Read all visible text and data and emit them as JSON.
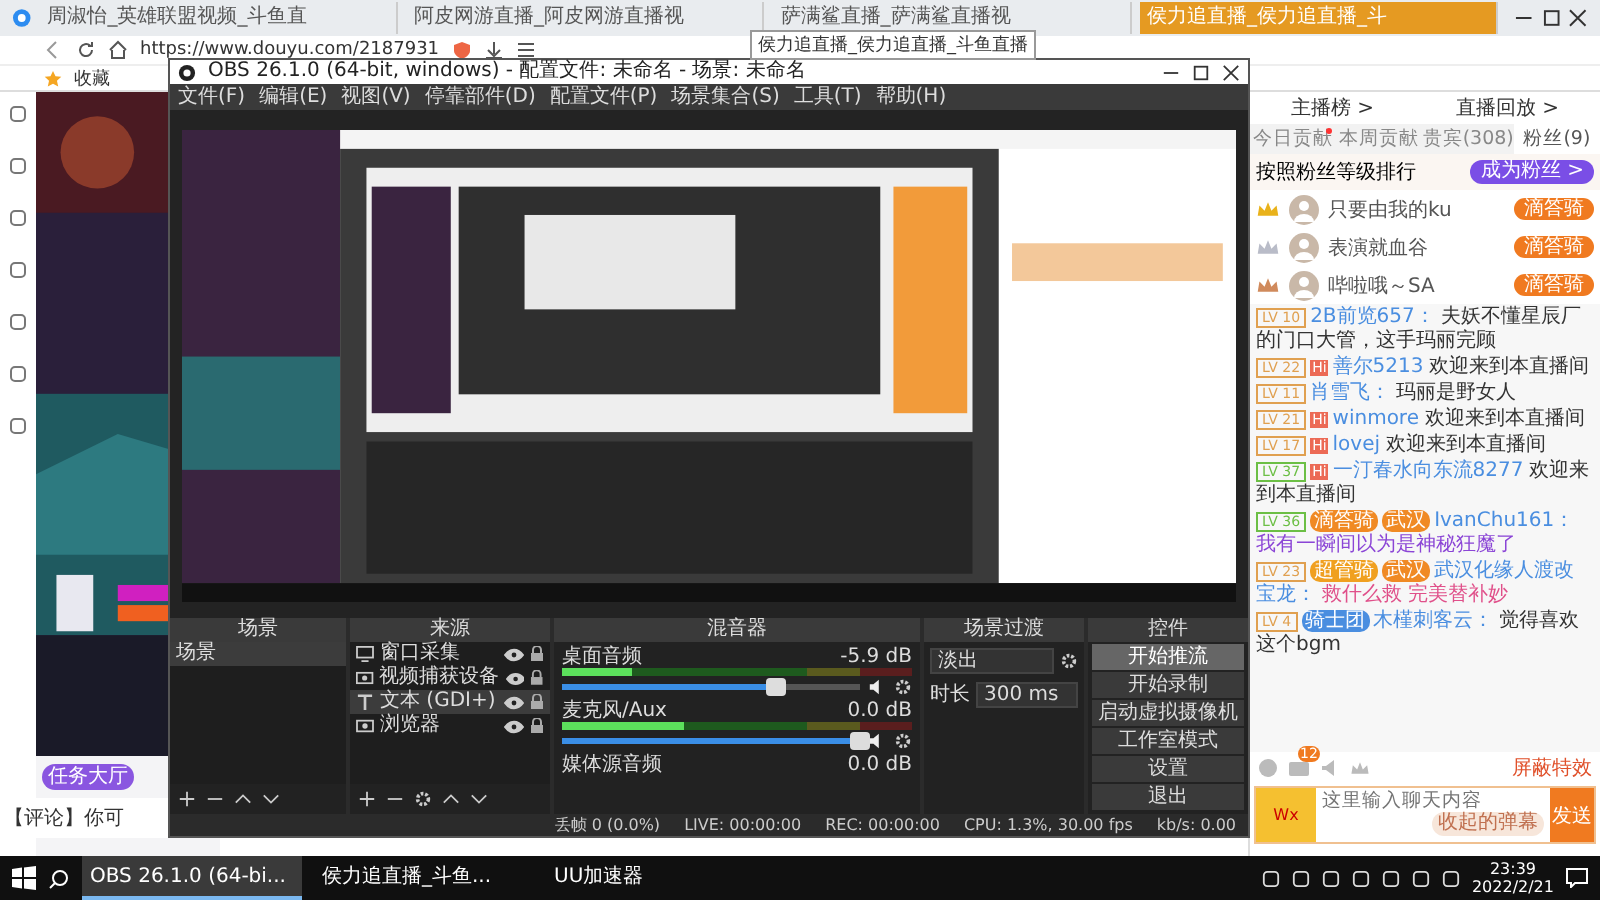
{
  "browser": {
    "tabs": [
      {
        "label": "周淑怡_英雄联盟视频_斗鱼直",
        "selected": false
      },
      {
        "label": "阿皮网游直播_阿皮网游直播视",
        "selected": false
      },
      {
        "label": "萨满鲨直播_萨满鲨直播视",
        "selected": false
      },
      {
        "label": "侯力追直播_侯力追直播_斗",
        "selected": true
      }
    ],
    "tooltip": "侯力追直播_侯力追直播_斗鱼直播",
    "address": "https://www.douyu.com/2187931",
    "bookmarks": [
      "收藏"
    ]
  },
  "stream": {
    "kind": "picture",
    "task_buttons": [
      "任务大厅"
    ],
    "notice": "【评论】你可"
  },
  "chat": {
    "links": [
      "主播榜 >",
      "直播回放 >"
    ],
    "tabs": [
      {
        "label": "今日贡献",
        "selected": false,
        "dot": true
      },
      {
        "label": "本周贡献",
        "selected": false,
        "dot": false
      },
      {
        "label": "贵宾(308)",
        "selected": false,
        "dot": false
      },
      {
        "label": "粉丝(9)",
        "selected": true,
        "dot": false
      }
    ],
    "rank_title": "按照粉丝等级排行",
    "join_button": "成为粉丝 >",
    "fans": [
      {
        "name": "只要由我的ku",
        "badge": "滴答骑",
        "crown": {
          "color": "#e9b21b"
        }
      },
      {
        "name": "表演就血谷",
        "badge": "滴答骑",
        "crown": {
          "color": "#b9bcc8"
        }
      },
      {
        "name": "哔啦哦～SA",
        "badge": "滴答骑",
        "crown": {
          "color": "#d08a5c"
        }
      }
    ],
    "messages": [
      {
        "tag": {
          "text": "LV 10",
          "color": "#e0a050"
        },
        "user": "2B前览657：",
        "text": "夫妖不懂星辰厂的门口大管，这手玛丽完顾",
        "color": "#333333"
      },
      {
        "tag": {
          "text": "LV 22",
          "color": "#e0a050"
        },
        "hi": "Hi",
        "user": "善尔5213",
        "text": "欢迎来到本直播间",
        "color": "#333333"
      },
      {
        "tag": {
          "text": "LV 11",
          "color": "#e0a050"
        },
        "user": "肖雪飞：",
        "text": "玛丽是野女人",
        "color": "#333333"
      },
      {
        "tag": {
          "text": "LV 21",
          "color": "#e0a050"
        },
        "hi": "Hi",
        "user": "winmore",
        "text": "欢迎来到本直播间",
        "color": "#333333"
      },
      {
        "tag": {
          "text": "LV 17",
          "color": "#e0a050"
        },
        "hi": "Hi",
        "user": "lovej",
        "text": "欢迎来到本直播间",
        "color": "#333333"
      },
      {
        "tag": {
          "text": "LV 37",
          "color": "#6cbf45"
        },
        "hi": "Hi",
        "user": "一汀春水向东流8277",
        "text": "欢迎来到本直播间",
        "color": "#333333"
      },
      {
        "tag": {
          "text": "LV 36",
          "color": "#6cbf45"
        },
        "badges": [
          {
            "text": "滴答骑",
            "color": "#f08a24"
          },
          {
            "text": "武汉",
            "color": "#f08a24"
          }
        ],
        "user": "IvanChu161：",
        "text": "我有一瞬间以为是神秘狂魔了",
        "color": "#8b45d6"
      },
      {
        "tag": {
          "text": "LV 23",
          "color": "#e0a050"
        },
        "badges": [
          {
            "text": "超管骑",
            "color": "#f0a020"
          },
          {
            "text": "武汉",
            "color": "#f08a24"
          }
        ],
        "user": "武汉化缘人渡改宝龙：",
        "text": "救什么救 完美替补妙",
        "color": "#e0508a"
      },
      {
        "tag": {
          "text": "LV 4",
          "color": "#e0a050"
        },
        "badges": [
          {
            "text": "骑士团",
            "color": "#4a8ee0"
          }
        ],
        "user": "木槿刺客云：",
        "text": "觉得喜欢这个bgm",
        "color": "#333333"
      }
    ],
    "unread": "12",
    "shield": "屏蔽特效",
    "input": {
      "placeholder": "这里输入聊天内容"
    },
    "collapse": "收起的弹幕",
    "send": "发送",
    "gift": "Wx"
  },
  "obs": {
    "title": "OBS 26.1.0 (64-bit, windows) - 配置文件: 未命名 - 场景: 未命名",
    "menu": [
      "文件(F)",
      "编辑(E)",
      "视图(V)",
      "停靠部件(D)",
      "配置文件(P)",
      "场景集合(S)",
      "工具(T)",
      "帮助(H)"
    ],
    "preview": {
      "kind": "picture"
    },
    "docks": [
      "场景",
      "来源",
      "混音器",
      "场景过渡",
      "控件"
    ],
    "scenes": [
      {
        "label": "场景",
        "selected": true
      }
    ],
    "sources": [
      {
        "label": "窗口采集",
        "kind": "monitor",
        "selected": false,
        "visible": true
      },
      {
        "label": "视频捕获设备",
        "kind": "camera",
        "selected": false,
        "visible": true
      },
      {
        "label": "文本 (GDI+)",
        "kind": "text",
        "selected": true,
        "visible": true
      },
      {
        "label": "浏览器",
        "kind": "camera",
        "selected": false,
        "visible": true
      }
    ],
    "mixer": [
      {
        "name": "桌面音频",
        "reading": "-5.9 dB",
        "meter": {
          "level": 0.2
        },
        "fader": {
          "level": 0.72
        }
      },
      {
        "name": "麦克风/Aux",
        "reading": "0.0 dB",
        "meter": {
          "level": 0.35
        },
        "fader": {
          "level": 1
        }
      },
      {
        "name": "媒体源音频",
        "reading": "0.0 dB"
      }
    ],
    "transition": {
      "value": "淡出",
      "duration_label": "时长",
      "duration": "300 ms"
    },
    "controls": [
      {
        "label": "开始推流",
        "selected": true
      },
      {
        "label": "开始录制",
        "selected": false
      },
      {
        "label": "启动虚拟摄像机",
        "selected": false
      },
      {
        "label": "工作室模式",
        "selected": false
      },
      {
        "label": "设置",
        "selected": false
      },
      {
        "label": "退出",
        "selected": false
      }
    ],
    "status": [
      "丢帧 0 (0.0%)",
      "LIVE: 00:00:00",
      "REC: 00:00:00",
      "CPU: 1.3%, 30.00 fps",
      "kb/s: 0.00"
    ]
  },
  "taskbar": {
    "apps": [
      {
        "label": "OBS 26.1.0 (64-bi...",
        "selected": true
      },
      {
        "label": "侯力追直播_斗鱼...",
        "selected": false
      },
      {
        "label": "UU加速器",
        "selected": false
      }
    ],
    "time": "23:39",
    "date": "2022/2/21"
  }
}
